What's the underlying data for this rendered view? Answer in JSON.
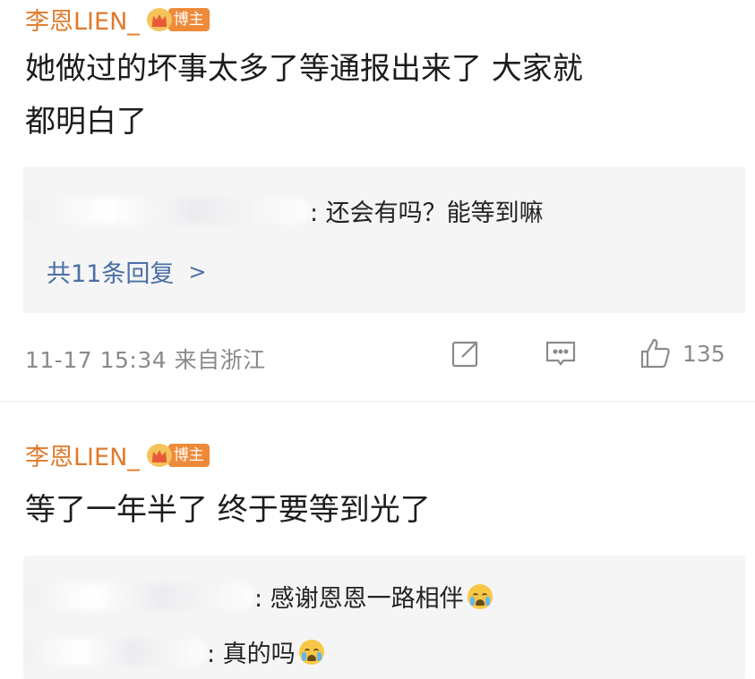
{
  "comments": [
    {
      "username": "李恩LIEN_",
      "badge": "博主",
      "text_line1": "她做过的坏事太多了等通报出来了  大家就",
      "text_line2": "都明白了",
      "replies": [
        {
          "text": ": 还会有吗？能等到嘛"
        }
      ],
      "reply_count": "共11条回复",
      "timestamp": "11-17 15:34 来自浙江",
      "likes": "135"
    },
    {
      "username": "李恩LIEN_",
      "badge": "博主",
      "text_line1": "等了一年半了  终于要等到光了",
      "replies": [
        {
          "text": ": 感谢恩恩一路相伴",
          "emoji": "crying-emoji"
        },
        {
          "text": ": 真的吗",
          "emoji": "crying-emoji"
        }
      ]
    }
  ],
  "icons": {
    "share": "share-icon",
    "comment": "comment-icon",
    "like": "thumbs-up-icon",
    "badge": "crown-badge-icon"
  },
  "colors": {
    "username": "#e07a2a",
    "link": "#4a6fa5",
    "meta": "#8a8a8a",
    "reply_bg": "#f5f5f6"
  }
}
